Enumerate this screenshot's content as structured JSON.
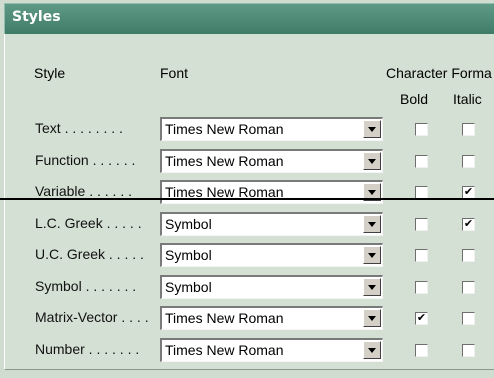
{
  "window": {
    "title": "Styles"
  },
  "headers": {
    "style": "Style",
    "font": "Font",
    "character_format": "Character Forma",
    "bold": "Bold",
    "italic": "Italic"
  },
  "rows": [
    {
      "label": "Text . . . . . . . .",
      "font": "Times New Roman",
      "bold": false,
      "italic": false
    },
    {
      "label": "Function . . . . . .",
      "font": "Times New Roman",
      "bold": false,
      "italic": false
    },
    {
      "label": "Variable . . . . . .",
      "font": "Times New Roman",
      "bold": false,
      "italic": true
    },
    {
      "label": "L.C. Greek . . . . .",
      "font": "Symbol",
      "bold": false,
      "italic": true
    },
    {
      "label": "U.C. Greek . . . . .",
      "font": "Symbol",
      "bold": false,
      "italic": false
    },
    {
      "label": "Symbol . . . . . . .",
      "font": "Symbol",
      "bold": false,
      "italic": false
    },
    {
      "label": "Matrix-Vector . . . .",
      "font": "Times New Roman",
      "bold": true,
      "italic": false
    },
    {
      "label": "Number . . . . . . .",
      "font": "Times New Roman",
      "bold": false,
      "italic": false
    }
  ],
  "check_glyph": "✔"
}
